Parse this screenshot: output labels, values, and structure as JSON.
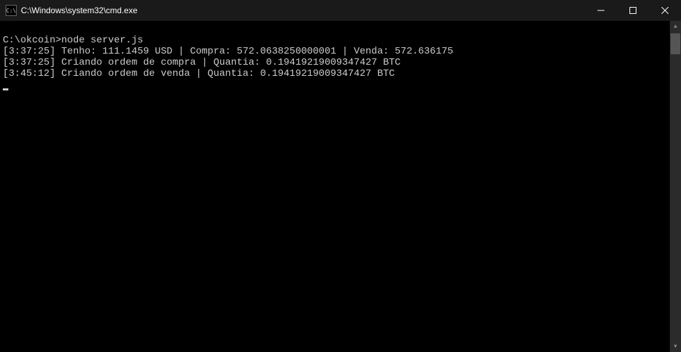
{
  "window": {
    "title": "C:\\Windows\\system32\\cmd.exe",
    "icon_label": "C:\\"
  },
  "terminal": {
    "prompt": "C:\\okcoin>",
    "command": "node server.js",
    "lines": [
      "[3:37:25] Tenho: 111.1459 USD | Compra: 572.0638250000001 | Venda: 572.636175",
      "[3:37:25] Criando ordem de compra | Quantia: 0.19419219009347427 BTC",
      "[3:45:12] Criando ordem de venda | Quantia: 0.19419219009347427 BTC"
    ]
  }
}
